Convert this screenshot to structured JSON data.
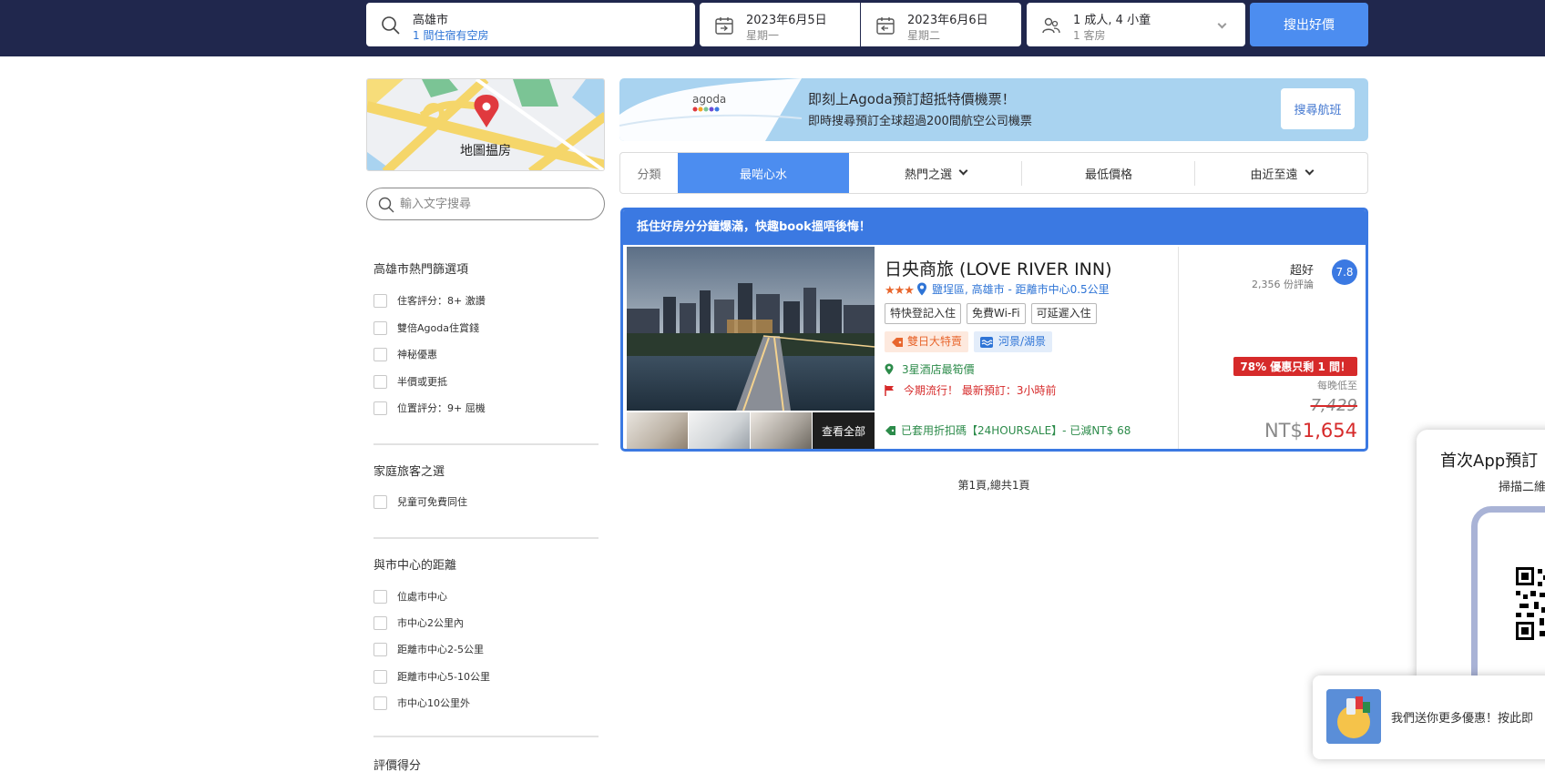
{
  "search": {
    "destination": "高雄市",
    "destination_sub": "1 間住宿有空房",
    "checkin_date": "2023年6月5日",
    "checkin_day": "星期一",
    "checkout_date": "2023年6月6日",
    "checkout_day": "星期二",
    "occupancy": "1 成人, 4 小童",
    "rooms": "1 客房",
    "button": "搜出好價"
  },
  "map": {
    "label": "地圖揾房"
  },
  "text_search": {
    "placeholder": "輸入文字搜尋"
  },
  "filters": {
    "popular": {
      "title": "高雄市熱門篩選項",
      "items": [
        "住客評分：8+ 激讚",
        "雙倍Agoda住賞錢",
        "神秘優惠",
        "半價或更抵",
        "位置評分：9+ 屈機"
      ]
    },
    "family": {
      "title": "家庭旅客之選",
      "items": [
        "兒童可免費同住"
      ]
    },
    "distance": {
      "title": "與市中心的距離",
      "items": [
        "位處市中心",
        "市中心2公里內",
        "距離市中心2-5公里",
        "距離市中心5-10公里",
        "市中心10公里外"
      ]
    },
    "rating_title": "評價得分"
  },
  "banner": {
    "logo": "agoda",
    "line1": "即刻上Agoda預訂超抵特價機票！",
    "line2": "即時搜尋預訂全球超過200間航空公司機票",
    "button": "搜尋航班"
  },
  "sort": {
    "label": "分類",
    "tabs": [
      "最啱心水",
      "熱門之選",
      "最低價格",
      "由近至遠"
    ]
  },
  "hotel": {
    "urgency": "抵住好房分分鐘爆滿，快趣book搵唔後悔！",
    "name": "日央商旅 (LOVE RIVER INN)",
    "stars": "★★★",
    "location": "鹽埕區, 高雄市 - 距離市中心0.5公里",
    "tags": [
      "特快登記入住",
      "免費Wi-Fi",
      "可延遲入住"
    ],
    "deal": "雙日大特賣",
    "view": "河景/湖景",
    "perk_best": "3星酒店最筍價",
    "perk_trending": "今期流行！ 最新預訂：3小時前",
    "coupon": "已套用折扣碼【24HOURSALE】- 已減NT$ 68",
    "see_all": "查看全部",
    "rating_word": "超好",
    "reviews": "2,356 份評論",
    "score": "7.8",
    "discount": "78% 優惠只剩 1 間！",
    "per_night": "每晚低至",
    "original_price": "7,429",
    "currency": "NT$",
    "price": "1,654"
  },
  "pagination": "第1頁,總共1頁",
  "app_popup": {
    "title": "首次App預訂",
    "subtitle": "掃描二維"
  },
  "toast": {
    "text": "我們送你更多優惠！按此即"
  }
}
